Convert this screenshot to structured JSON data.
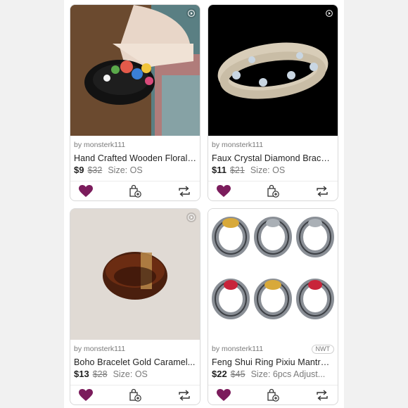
{
  "listings": [
    {
      "seller": "by monsterk111",
      "title": "Hand Crafted Wooden Floral B...",
      "price": "$9",
      "original_price": "$32",
      "size": "Size: OS",
      "tag": "",
      "liked": true,
      "has_video": true,
      "image_icon": "floral-bangle"
    },
    {
      "seller": "by monsterk111",
      "title": "Faux Crystal Diamond Bracelet",
      "price": "$11",
      "original_price": "$21",
      "size": "Size: OS",
      "tag": "",
      "liked": true,
      "has_video": true,
      "image_icon": "crystal-bracelet"
    },
    {
      "seller": "by monsterk111",
      "title": "Boho Bracelet Gold Caramel...",
      "price": "$13",
      "original_price": "$28",
      "size": "Size: OS",
      "tag": "",
      "liked": true,
      "has_video": true,
      "image_icon": "caramel-cuff"
    },
    {
      "seller": "by monsterk111",
      "title": "Feng Shui Ring Pixiu Mantra Ri...",
      "price": "$22",
      "original_price": "$45",
      "size": "Size: 6pcs Adjust...",
      "tag": "NWT",
      "liked": true,
      "has_video": false,
      "image_icon": "pixiu-rings"
    }
  ],
  "colors": {
    "heart": "#7b1c5c",
    "text": "#222222",
    "muted": "#7a7a7a"
  }
}
